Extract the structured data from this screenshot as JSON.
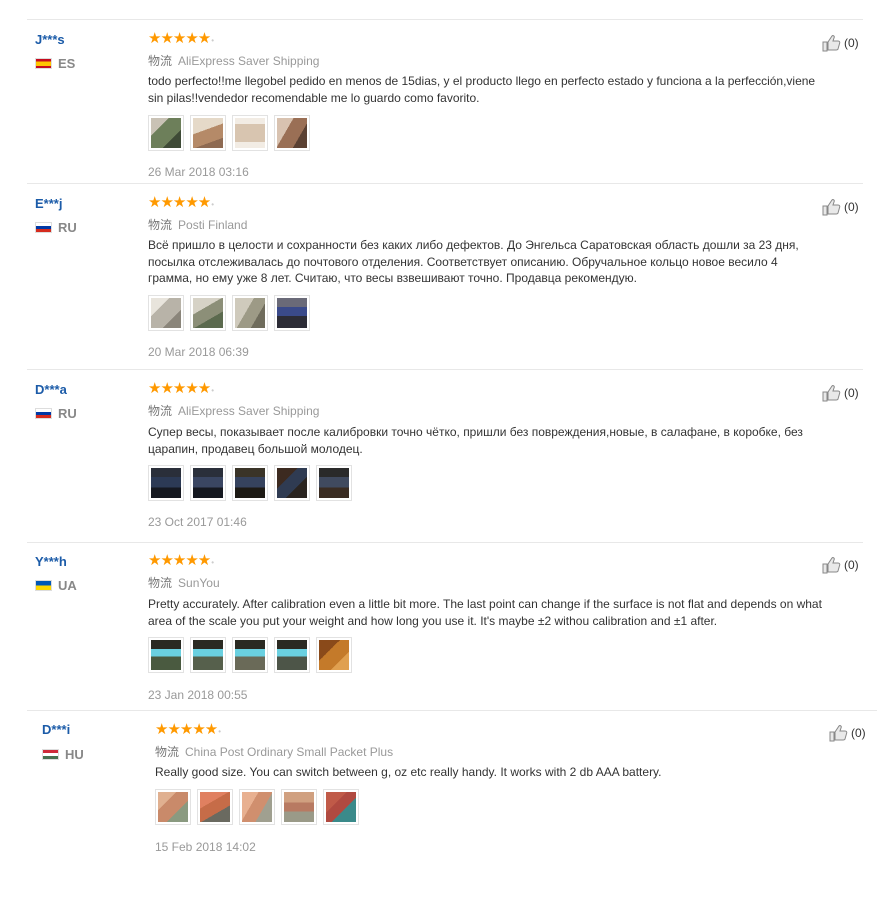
{
  "reviews": [
    {
      "user": "J***s",
      "country": "ES",
      "rating": 5,
      "stars": "★★★★★",
      "shipping_prefix": "物流",
      "shipping": "AliExpress Saver Shipping",
      "text_lines": [
        "todo perfecto!!me llegobel pedido en menos de 15dias, y el producto llego en perfecto estado y funciona a la perfección,viene",
        "sin pilas!!vendedor recomendable me lo guardo como favorito."
      ],
      "helpful": "(0)",
      "date": "26 Mar 2018 03:16",
      "photos": [
        "#6d7f5a",
        "#b58a68",
        "#d8c5b0",
        "#9a6f55"
      ]
    },
    {
      "user": "E***j",
      "country": "RU",
      "rating": 5,
      "stars": "★★★★★",
      "shipping_prefix": "物流",
      "shipping": "Posti Finland",
      "text_lines": [
        "Всё пришло в целости и сохранности без каких либо дефектов. До Энгельса Саратовская область дошли за 23 дня,",
        "посылка отслеживалась до почтового отделения. Соответствует описанию. Обручальное кольцо новое весило 4",
        "грамма, но ему уже 8 лет. Считаю, что весы взвешивают точно. Продавца рекомендую."
      ],
      "helpful": "(0)",
      "date": "20 Mar 2018 06:39",
      "photos": [
        "#b8b3a8",
        "#8c8f78",
        "#9d9a86",
        "#4a4a5a"
      ]
    },
    {
      "user": "D***a",
      "country": "RU",
      "rating": 5,
      "stars": "★★★★★",
      "shipping_prefix": "物流",
      "shipping": "AliExpress Saver Shipping",
      "text_lines": [
        "Супер весы, показывает после калибровки точно чётко, пришли без повреждения,новые, в салафане, в коробке, без",
        "царапин, продавец большой молодец."
      ],
      "helpful": "(0)",
      "date": "23 Oct 2017 01:46",
      "photos": [
        "#2c3a55",
        "#3a4662",
        "#36435e",
        "#2f3b52",
        "#404a5f"
      ]
    },
    {
      "user": "Y***h",
      "country": "UA",
      "rating": 5,
      "stars": "★★★★★",
      "shipping_prefix": "物流",
      "shipping": "SunYou",
      "text_lines": [
        "Pretty accurately. After calibration even a little bit more. The last point can change if the surface is not flat and depends on what",
        "area of the scale you put your weight and how long you use it. It's maybe ±2 withou calibration and ±1 after."
      ],
      "helpful": "(0)",
      "date": "23 Jan 2018 00:55",
      "photos": [
        "#4a5a40",
        "#56604c",
        "#6a6a58",
        "#4d5548",
        "#c47a2a"
      ]
    },
    {
      "user": "D***i",
      "country": "HU",
      "rating": 5,
      "stars": "★★★★★",
      "shipping_prefix": "物流",
      "shipping": "China Post Ordinary Small Packet Plus",
      "text_lines": [
        "Really good size. You can switch between g, oz etc really handy. It works with 2 db AAA battery."
      ],
      "helpful": "(0)",
      "date": "15 Feb 2018 14:02",
      "photos": [
        "#c98a6a",
        "#c66c48",
        "#d08f6e",
        "#b87a62",
        "#b04a40"
      ]
    }
  ]
}
